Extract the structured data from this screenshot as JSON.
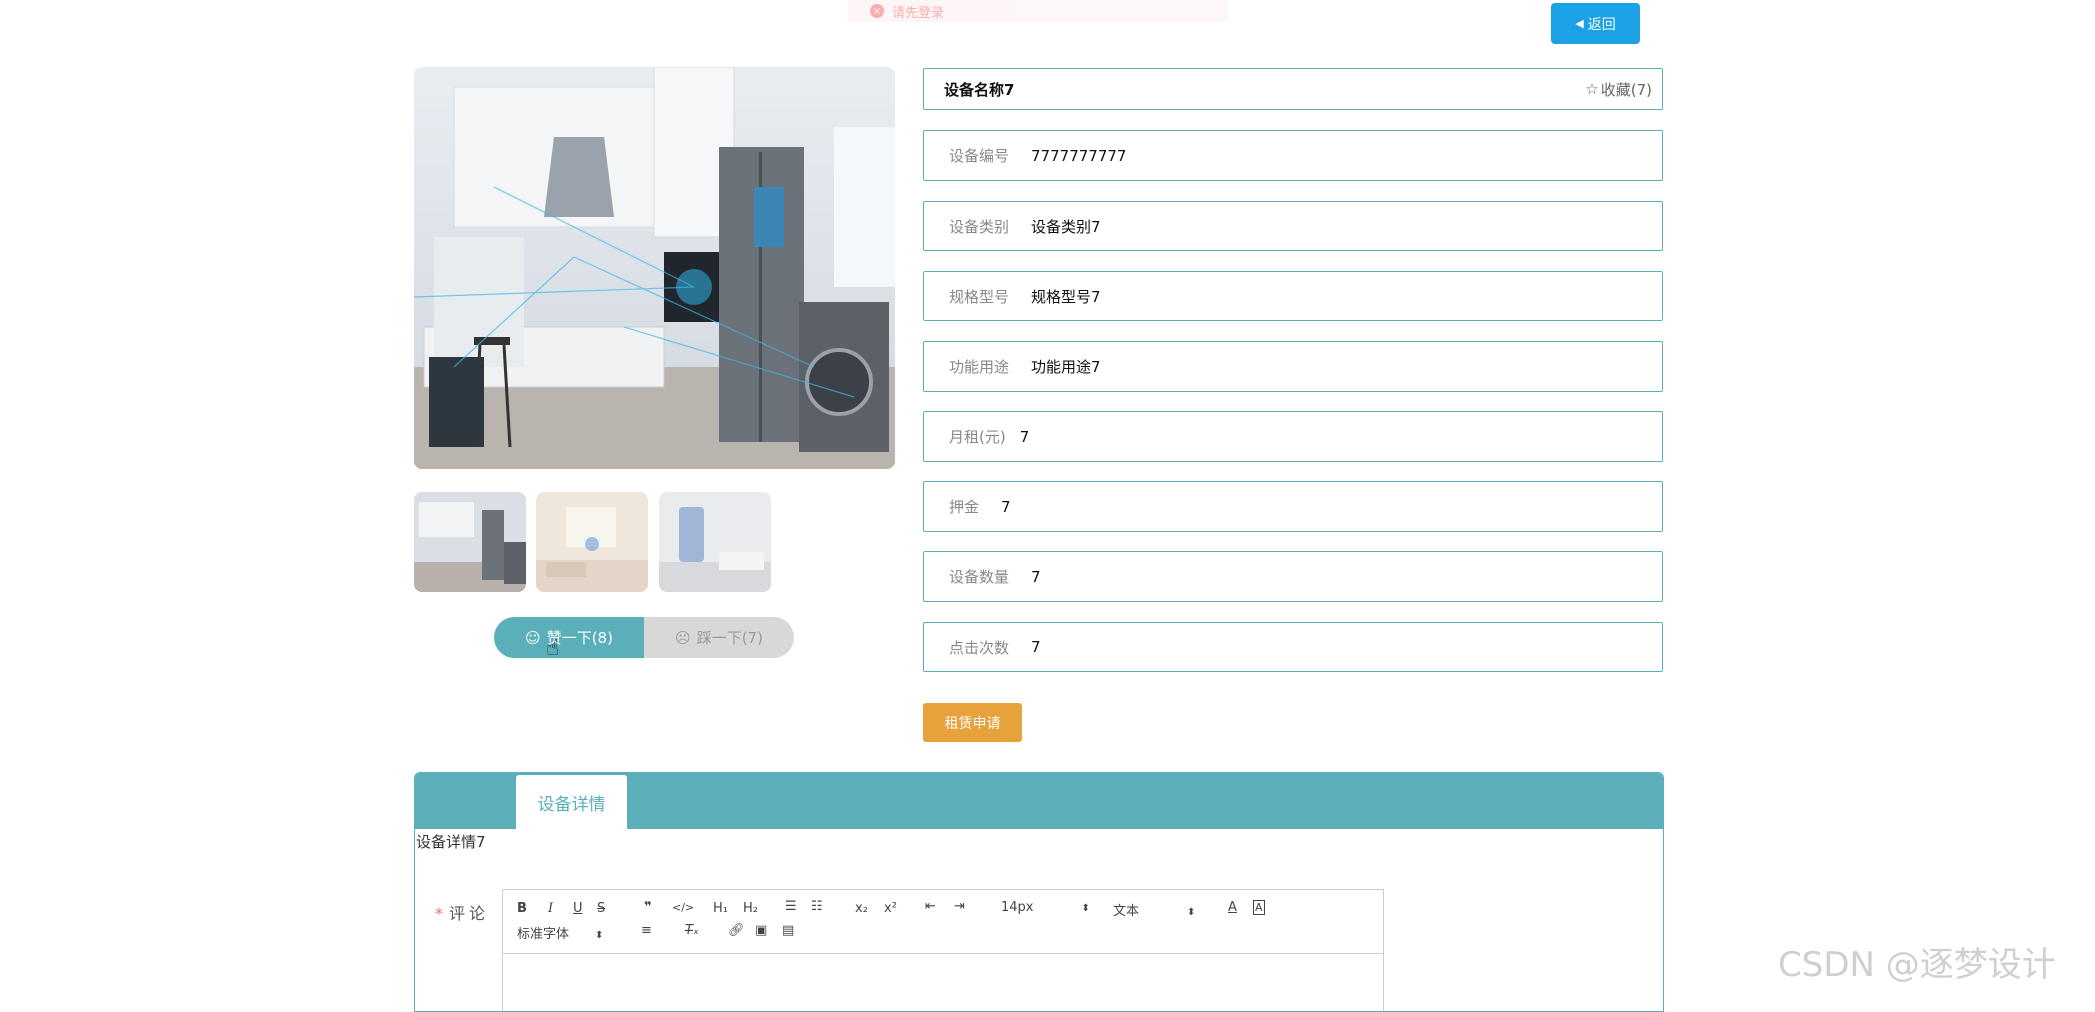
{
  "toast": {
    "text": "请先登录"
  },
  "header": {
    "back_label": "返回"
  },
  "product": {
    "name": "设备名称7",
    "favorite_label": "收藏(7)",
    "fields": [
      {
        "label": "设备编号",
        "value": "7777777777"
      },
      {
        "label": "设备类别",
        "value": "设备类别7"
      },
      {
        "label": "规格型号",
        "value": "规格型号7"
      },
      {
        "label": "功能用途",
        "value": "功能用途7"
      },
      {
        "label": "月租(元)",
        "value": "7"
      },
      {
        "label": "押金",
        "value": "7"
      },
      {
        "label": "设备数量",
        "value": "7"
      },
      {
        "label": "点击次数",
        "value": "7"
      }
    ],
    "rent_button": "租赁申请"
  },
  "votes": {
    "like_label": "赞一下(8)",
    "dislike_label": "踩一下(7)"
  },
  "tabs": {
    "active_label": "设备详情",
    "detail_text": "设备详情7"
  },
  "comment": {
    "required_mark": "*",
    "label": "评论",
    "font_size": "14px",
    "text_type": "文本",
    "font_family": "标准字体"
  },
  "watermark": "CSDN @逐梦设计",
  "colors": {
    "accent": "#5aafbb",
    "back_button": "#1aa1e6",
    "rent_button": "#e8a23c"
  }
}
